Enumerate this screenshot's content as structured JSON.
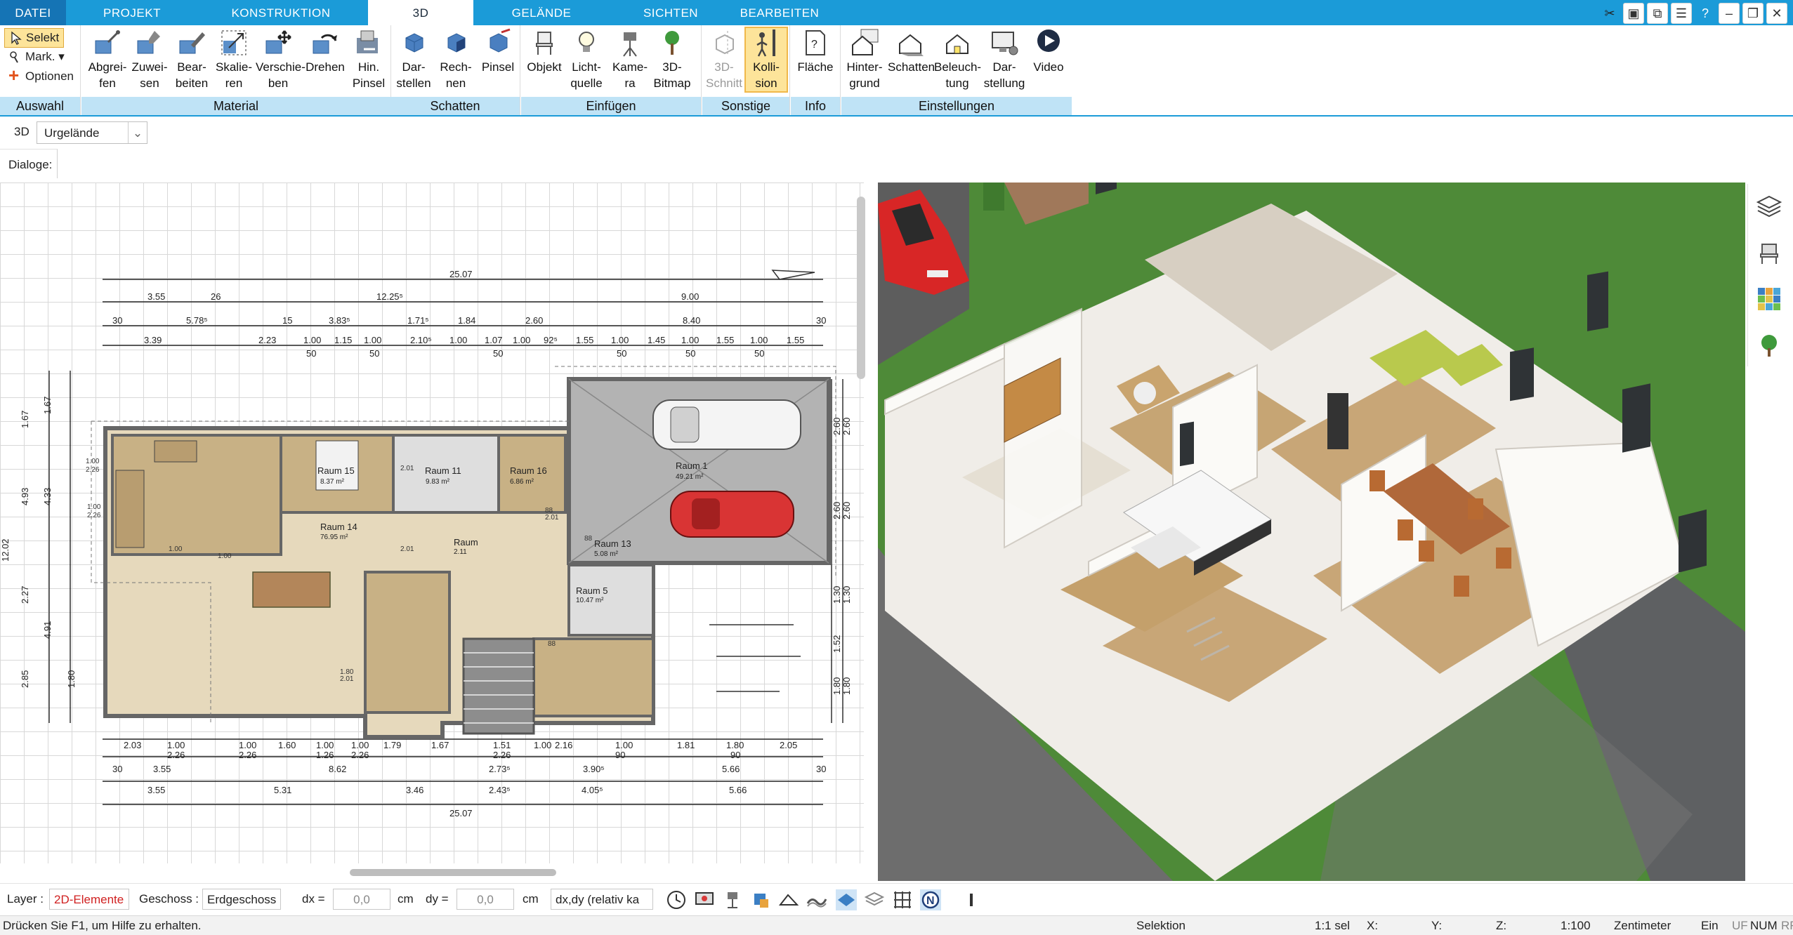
{
  "menu": {
    "tabs": [
      "DATEI",
      "PROJEKT",
      "KONSTRUKTION",
      "3D",
      "GELÄNDE",
      "SICHTEN",
      "BEARBEITEN"
    ],
    "active": "3D"
  },
  "ribbon": {
    "auswahl": {
      "label": "Auswahl",
      "selekt": "Selekt",
      "mark": "Mark.",
      "optionen": "Optionen"
    },
    "material": {
      "label": "Material",
      "buttons": [
        [
          "Abgrei-",
          "fen"
        ],
        [
          "Zuwei-",
          "sen"
        ],
        [
          "Bear-",
          "beiten"
        ],
        [
          "Skalie-",
          "ren"
        ],
        [
          "Verschie-",
          "ben"
        ],
        [
          "Drehen",
          ""
        ],
        [
          "Hin.",
          "Pinsel"
        ]
      ]
    },
    "schatten": {
      "label": "Schatten",
      "buttons": [
        [
          "Dar-",
          "stellen"
        ],
        [
          "Rech-",
          "nen"
        ],
        [
          "Pinsel",
          ""
        ]
      ]
    },
    "einfuegen": {
      "label": "Einfügen",
      "buttons": [
        [
          "Objekt",
          ""
        ],
        [
          "Licht-",
          "quelle ▾"
        ],
        [
          "Kame-",
          "ra"
        ],
        [
          "3D-",
          "Bitmap"
        ]
      ]
    },
    "sonstige": {
      "label": "Sonstige",
      "buttons": [
        [
          "3D-",
          "Schnitt"
        ],
        [
          "Kolli-",
          "sion"
        ]
      ]
    },
    "info": {
      "label": "Info",
      "buttons": [
        [
          "Fläche",
          ""
        ]
      ]
    },
    "einstellungen": {
      "label": "Einstellungen",
      "buttons": [
        [
          "Hinter-",
          "grund"
        ],
        [
          "Schatten",
          ""
        ],
        [
          "Beleuch-",
          "tung"
        ],
        [
          "Dar-",
          "stellung"
        ],
        [
          "Video",
          ""
        ]
      ]
    }
  },
  "context": {
    "mode": "3D",
    "terrain": "Urgelände",
    "dialoge": "Dialoge:"
  },
  "plan": {
    "dims_top_total": "25.07",
    "dims_bottom_total": "25.07",
    "dims_top_row1": [
      "3.55",
      "26",
      "12.25⁵",
      "9.00"
    ],
    "dims_top_row2": [
      "30",
      "5.78⁵",
      "15",
      "3.83⁵",
      "1.71⁵",
      "1.84",
      "2.60",
      "8.40",
      "30"
    ],
    "dims_top_row3": [
      "3.39",
      "2.23",
      "1.00",
      "1.15",
      "1.00",
      "2.10⁵",
      "1.00",
      "1.07",
      "1.00",
      "92⁵",
      "1.55",
      "1.00",
      "1.45",
      "1.00",
      "1.55",
      "1.00",
      "1.55"
    ],
    "dims_top_row3_sub": [
      "50",
      "50",
      "50",
      "50",
      "50",
      "50"
    ],
    "dims_bottom_row1": [
      "2.03",
      "1.00",
      "1.00",
      "1.60",
      "1.00",
      "1.00",
      "1.79",
      "1.67",
      "1.51",
      "1.00",
      "2.16",
      "1.00",
      "1.81",
      "1.80",
      "2.05"
    ],
    "dims_bottom_row1_sub": [
      "2.26",
      "2.26",
      "1.26",
      "2.26",
      "2.26",
      "90",
      "90"
    ],
    "dims_bottom_row2": [
      "30",
      "3.55",
      "8.62",
      "2.73⁵",
      "3.90⁵",
      "5.66",
      "30"
    ],
    "dims_bottom_row3": [
      "3.55",
      "5.31",
      "3.46",
      "2.43⁵",
      "4.05⁵",
      "5.66"
    ],
    "dims_left": [
      "1.67",
      "1.67",
      "4.93",
      "4.33",
      "12.02",
      "2.27",
      "4.91",
      "2.85",
      "1.80"
    ],
    "dims_right": [
      "2.60",
      "2.60",
      "2.60",
      "2.60",
      "1.30",
      "1.30",
      "1.52",
      "1.80",
      "1.80"
    ],
    "rooms": [
      {
        "name": "Raum 1",
        "area": "49.21 m²"
      },
      {
        "name": "Raum 15",
        "area": "8.37 m²"
      },
      {
        "name": "Raum 11",
        "area": "9.83 m²"
      },
      {
        "name": "Raum 16",
        "area": "6.86 m²"
      },
      {
        "name": "Raum 14",
        "area": "76.95 m²"
      },
      {
        "name": "Raum 13",
        "area": "5.08 m²"
      },
      {
        "name": "Raum 5",
        "area": "10.47 m²"
      },
      {
        "name": "Raum",
        "area": "2.11"
      }
    ],
    "small_labels": [
      "1.00",
      "2.26",
      "2.01",
      "2.01",
      "1.00",
      "2.26",
      "1.00",
      "1.00",
      "88",
      "2.01",
      "1.80",
      "2.01",
      "88",
      "88"
    ]
  },
  "bottombar": {
    "layer_label": "Layer :",
    "layer_value": "2D-Elemente",
    "geschoss_label": "Geschoss :",
    "geschoss_value": "Erdgeschoss",
    "dx_label": "dx =",
    "dx_value": "0,0",
    "dy_label": "dy =",
    "dy_value": "0,0",
    "unit": "cm",
    "mode": "dx,dy (relativ ka"
  },
  "status": {
    "help": "Drücken Sie F1, um Hilfe zu erhalten.",
    "selektion": "Selektion",
    "scale_sel": "1:1 sel",
    "x": "X:",
    "y": "Y:",
    "z": "Z:",
    "scale": "1:100",
    "unit": "Zentimeter",
    "ein": "Ein",
    "uf": "UF",
    "num": "NUM",
    "rf": "RF"
  },
  "colors": {
    "accent": "#1b9bd8",
    "accent_dark": "#1574b5",
    "group_label": "#bfe3f6",
    "selected": "#fde49a",
    "grass": "#4e8a38",
    "floor": "#c9ab79",
    "car_red": "#d62020"
  }
}
